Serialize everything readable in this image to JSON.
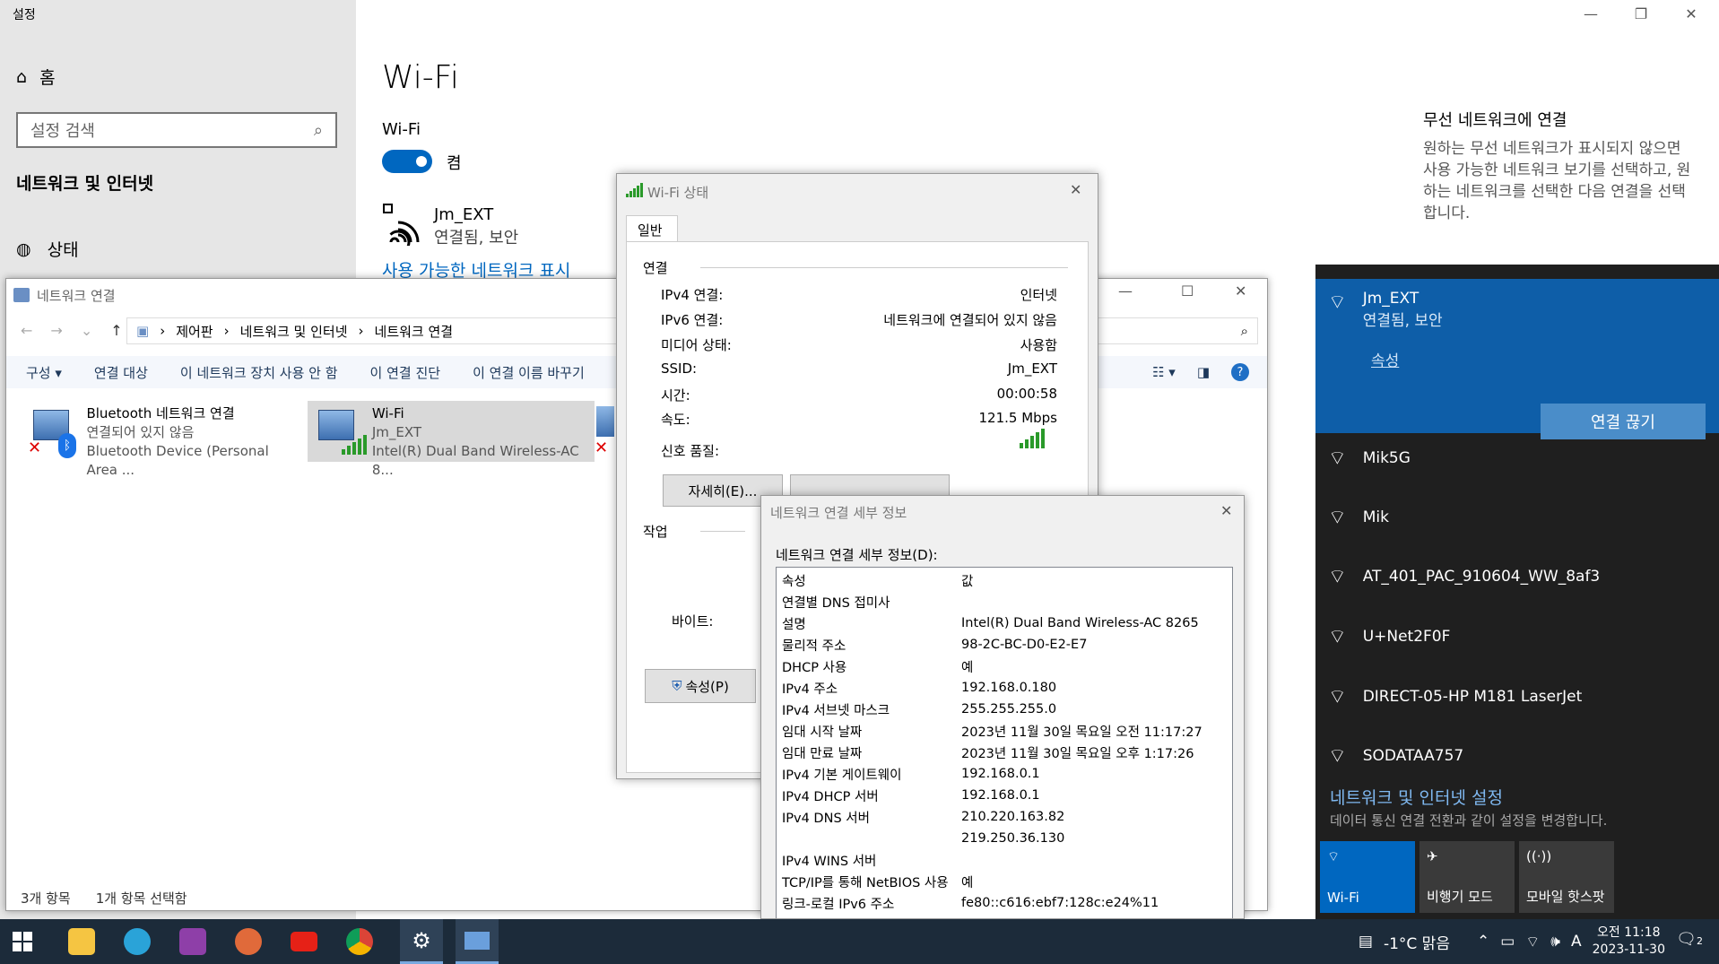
{
  "settings": {
    "app_title": "설정",
    "home": "홈",
    "search_placeholder": "설정 검색",
    "section": "네트워크 및 인터넷",
    "status_item": "상태",
    "page_title": "Wi-Fi",
    "wifi_label": "Wi-Fi",
    "toggle_state": "켬",
    "network_name": "Jm_EXT",
    "network_status": "연결됨, 보안",
    "show_networks_link": "사용 가능한 네트워크 표시",
    "related_title": "무선 네트워크에 연결",
    "related_text": "원하는 무선 네트워크가 표시되지 않으면 사용 가능한 네트워크 보기를 선택하고, 원하는 네트워크를 선택한 다음 연결을 선택합니다."
  },
  "netconn": {
    "title": "네트워크 연결",
    "breadcrumb": [
      "제어판",
      "네트워크 및 인터넷",
      "네트워크 연결"
    ],
    "toolbar": [
      "구성 ▾",
      "연결 대상",
      "이 네트워크 장치 사용 안 함",
      "이 연결 진단",
      "이 연결 이름 바꾸기"
    ],
    "adapters": [
      {
        "name": "Bluetooth 네트워크 연결",
        "status": "연결되어 있지 않음",
        "device": "Bluetooth Device (Personal Area ..."
      },
      {
        "name": "Wi-Fi",
        "status": "Jm_EXT",
        "device": "Intel(R) Dual Band Wireless-AC 8..."
      }
    ],
    "status_count": "3개 항목",
    "status_selected": "1개 항목 선택함"
  },
  "wifi_status": {
    "title": "Wi-Fi 상태",
    "tab": "일반",
    "group_connection": "연결",
    "rows": [
      {
        "k": "IPv4 연결:",
        "v": "인터넷"
      },
      {
        "k": "IPv6 연결:",
        "v": "네트워크에 연결되어 있지 않음"
      },
      {
        "k": "미디어 상태:",
        "v": "사용함"
      },
      {
        "k": "SSID:",
        "v": "Jm_EXT"
      },
      {
        "k": "시간:",
        "v": "00:00:58"
      },
      {
        "k": "속도:",
        "v": "121.5 Mbps"
      }
    ],
    "signal_label": "신호 품질:",
    "details_button": "자세히(E)...",
    "group_activity": "작업",
    "bytes_label": "바이트:",
    "properties_button": "속성(P)"
  },
  "details": {
    "title": "네트워크 연결 세부 정보",
    "label": "네트워크 연결 세부 정보(D):",
    "header_k": "속성",
    "header_v": "값",
    "rows": [
      {
        "k": "연결별 DNS 접미사",
        "v": ""
      },
      {
        "k": "설명",
        "v": "Intel(R) Dual Band Wireless-AC 8265"
      },
      {
        "k": "물리적 주소",
        "v": "98-2C-BC-D0-E2-E7"
      },
      {
        "k": "DHCP 사용",
        "v": "예"
      },
      {
        "k": "IPv4 주소",
        "v": "192.168.0.180"
      },
      {
        "k": "IPv4 서브넷 마스크",
        "v": "255.255.255.0"
      },
      {
        "k": "임대 시작 날짜",
        "v": "2023년 11월 30일 목요일 오전 11:17:27"
      },
      {
        "k": "임대 만료 날짜",
        "v": "2023년 11월 30일 목요일 오후 1:17:26"
      },
      {
        "k": "IPv4 기본 게이트웨이",
        "v": "192.168.0.1"
      },
      {
        "k": "IPv4 DHCP 서버",
        "v": "192.168.0.1"
      },
      {
        "k": "IPv4 DNS 서버",
        "v": "210.220.163.82"
      },
      {
        "k": "",
        "v": "219.250.36.130"
      },
      {
        "k": "IPv4 WINS 서버",
        "v": ""
      },
      {
        "k": "TCP/IP를 통해 NetBIOS 사용",
        "v": "예"
      },
      {
        "k": "링크-로컬 IPv6 주소",
        "v": "fe80::c616:ebf7:128c:e24%11"
      }
    ]
  },
  "flyout": {
    "active": {
      "name": "Jm_EXT",
      "status": "연결됨, 보안",
      "properties": "속성",
      "disconnect": "연결 끊기"
    },
    "networks": [
      "Mik5G",
      "Mik",
      "AT_401_PAC_910604_WW_8af3",
      "U+Net2F0F",
      "DIRECT-05-HP M181 LaserJet",
      "SODATAA757"
    ],
    "settings_link": "네트워크 및 인터넷 설정",
    "settings_sub": "데이터 통신 연결 전환과 같이 설정을 변경합니다.",
    "tiles": [
      "Wi-Fi",
      "비행기 모드",
      "모바일 핫스팟"
    ]
  },
  "taskbar": {
    "weather": "-1°C 맑음",
    "ime": "A",
    "time": "오전 11:18",
    "date": "2023-11-30",
    "notif_count": "2"
  }
}
